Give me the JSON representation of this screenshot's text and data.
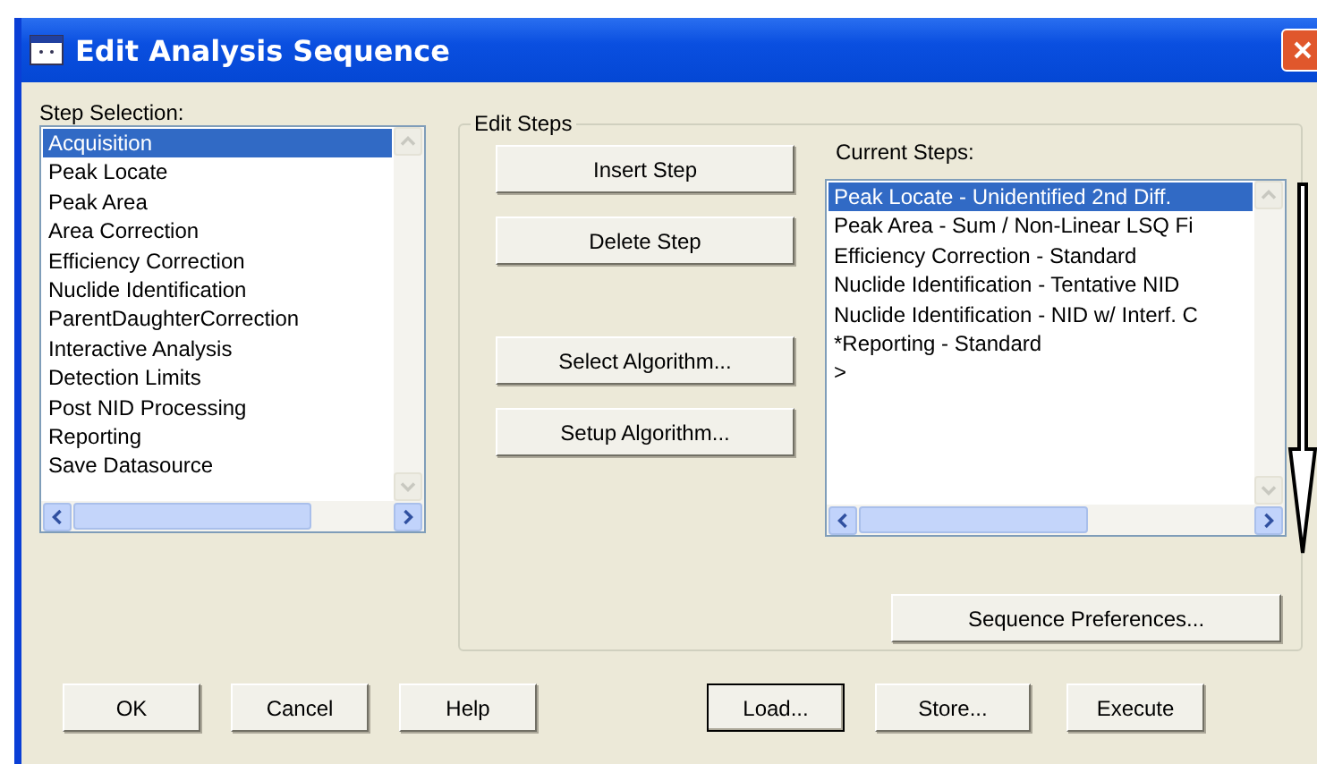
{
  "window": {
    "title": "Edit Analysis Sequence"
  },
  "step_selection": {
    "label": "Step Selection:",
    "items": [
      {
        "label": "Acquisition",
        "selected": true
      },
      {
        "label": "Peak Locate",
        "selected": false
      },
      {
        "label": "Peak Area",
        "selected": false
      },
      {
        "label": "Area Correction",
        "selected": false
      },
      {
        "label": "Efficiency Correction",
        "selected": false
      },
      {
        "label": "Nuclide Identification",
        "selected": false
      },
      {
        "label": "ParentDaughterCorrection",
        "selected": false
      },
      {
        "label": "Interactive Analysis",
        "selected": false
      },
      {
        "label": "Detection Limits",
        "selected": false
      },
      {
        "label": "Post NID Processing",
        "selected": false
      },
      {
        "label": "Reporting",
        "selected": false
      },
      {
        "label": "Save Datasource",
        "selected": false
      }
    ]
  },
  "edit_steps": {
    "title": "Edit Steps",
    "buttons": [
      {
        "label": "Insert Step"
      },
      {
        "label": "Delete Step"
      },
      {
        "label": "Select Algorithm..."
      },
      {
        "label": "Setup Algorithm..."
      }
    ],
    "current_steps": {
      "label": "Current Steps:",
      "items": [
        {
          "label": "Peak Locate - Unidentified 2nd Diff.",
          "selected": true
        },
        {
          "label": "Peak Area - Sum / Non-Linear LSQ Fi",
          "selected": false
        },
        {
          "label": "Efficiency Correction - Standard",
          "selected": false
        },
        {
          "label": "Nuclide Identification - Tentative NID",
          "selected": false
        },
        {
          "label": "Nuclide Identification - NID w/ Interf. C",
          "selected": false
        },
        {
          "label": "*Reporting - Standard",
          "selected": false
        },
        {
          "label": ">",
          "selected": false
        }
      ]
    },
    "preferences_button": "Sequence Preferences..."
  },
  "footer_buttons": [
    {
      "label": "OK",
      "default": false
    },
    {
      "label": "Cancel",
      "default": false
    },
    {
      "label": "Help",
      "default": false
    },
    {
      "label": "Load...",
      "default": true
    },
    {
      "label": "Store...",
      "default": false
    },
    {
      "label": "Execute",
      "default": false
    }
  ]
}
